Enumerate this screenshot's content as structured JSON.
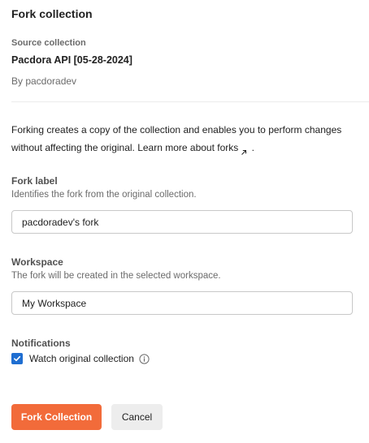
{
  "dialog": {
    "title": "Fork collection"
  },
  "source": {
    "label": "Source collection",
    "name": "Pacdora API [05-28-2024]",
    "owner": "By pacdoradev"
  },
  "description": {
    "text": "Forking creates a copy of the collection and enables you to perform changes without affecting the original. Learn more about forks",
    "suffix": " ."
  },
  "fork_label": {
    "label": "Fork label",
    "help": "Identifies the fork from the original collection.",
    "value": "pacdoradev's fork"
  },
  "workspace": {
    "label": "Workspace",
    "help": "The fork will be created in the selected workspace.",
    "value": "My Workspace"
  },
  "notifications": {
    "label": "Notifications",
    "watch_label": "Watch original collection",
    "watch_checked": true
  },
  "actions": {
    "primary_label": "Fork Collection",
    "cancel_label": "Cancel"
  },
  "colors": {
    "accent": "#f26b3a",
    "checkbox": "#1f6ed1"
  },
  "icons": {
    "external_link": "external-link-icon",
    "info": "info-icon",
    "checkmark": "checkmark-icon"
  }
}
